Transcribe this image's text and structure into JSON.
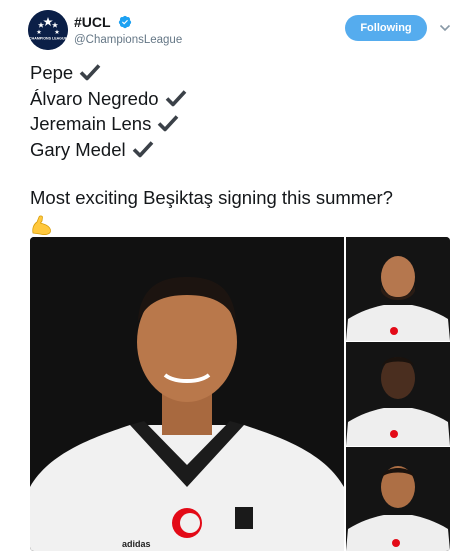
{
  "account": {
    "display_name": "#UCL",
    "handle": "@ChampionsLeague",
    "verified": true,
    "avatar_icon": "champions-league-logo-icon",
    "avatar_text": "CHAMPIONS LEAGUE"
  },
  "actions": {
    "follow_label": "Following",
    "menu_icon": "chevron-down-icon"
  },
  "tweet": {
    "lines": [
      {
        "text": "Pepe",
        "icon": "check-mark-icon"
      },
      {
        "text": "Álvaro Negredo",
        "icon": "check-mark-icon"
      },
      {
        "text": "Jeremain Lens",
        "icon": "check-mark-icon"
      },
      {
        "text": "Gary Medel",
        "icon": "check-mark-icon"
      }
    ],
    "question": "Most exciting Beşiktaş signing this summer?",
    "emoji": "flexed-biceps-icon"
  },
  "media": {
    "main_photo": "player-photo-pepe",
    "side_photos": [
      "player-photo-negredo",
      "player-photo-lens",
      "player-photo-medel"
    ],
    "kit_text": "adidas"
  },
  "colors": {
    "accent": "#55acee",
    "verified": "#1da1f2",
    "text": "#14171a",
    "muted": "#657786",
    "avatar_bg": "#0b1f47",
    "photo_bg": "#111111"
  }
}
